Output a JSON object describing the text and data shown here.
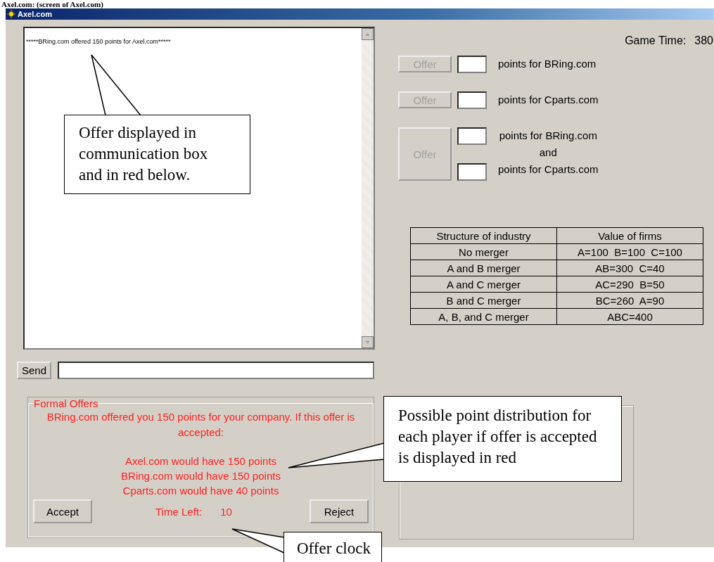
{
  "heading": "Axel.com: (screen of Axel.com)",
  "window": {
    "title": "Axel.com"
  },
  "communication": {
    "messages": [
      "*****BRing.com offered 150 points for Axel.com*****"
    ]
  },
  "send": {
    "button": "Send"
  },
  "game_time": {
    "label": "Game Time:",
    "value": "380"
  },
  "offers": [
    {
      "kind": "single",
      "button": "Offer",
      "disabled": true,
      "labels": [
        "points for BRing.com"
      ]
    },
    {
      "kind": "single",
      "button": "Offer",
      "disabled": true,
      "labels": [
        "points for Cparts.com"
      ]
    },
    {
      "kind": "double",
      "button": "Offer",
      "disabled": true,
      "labels": [
        "points for BRing.com",
        "and",
        "points for Cparts.com"
      ]
    }
  ],
  "table": {
    "columns": [
      "Structure of industry",
      "Value of firms"
    ],
    "rows": [
      [
        "No merger",
        "A=100  B=100  C=100"
      ],
      [
        "A and B merger",
        "AB=300  C=40"
      ],
      [
        "A and C merger",
        "AC=290  B=50"
      ],
      [
        "B and C merger",
        "BC=260  A=90"
      ],
      [
        "A, B, and C merger",
        "ABC=400"
      ]
    ]
  },
  "formal_offers": {
    "legend": "Formal Offers",
    "message": "BRing.com offered you 150 points for your company. If this offer is accepted:",
    "outcomes": [
      "Axel.com would have 150 points",
      "BRing.com would have 150 points",
      "Cparts.com would have 40 points"
    ],
    "time_label": "Time Left:",
    "time_value": "10",
    "accept": "Accept",
    "reject": "Reject"
  },
  "callouts": [
    {
      "text": "Offer displayed in communication box and in red below."
    },
    {
      "text": "Possible point distribution for each player if offer is accepted is displayed in red"
    },
    {
      "text": "Offer clock"
    }
  ]
}
